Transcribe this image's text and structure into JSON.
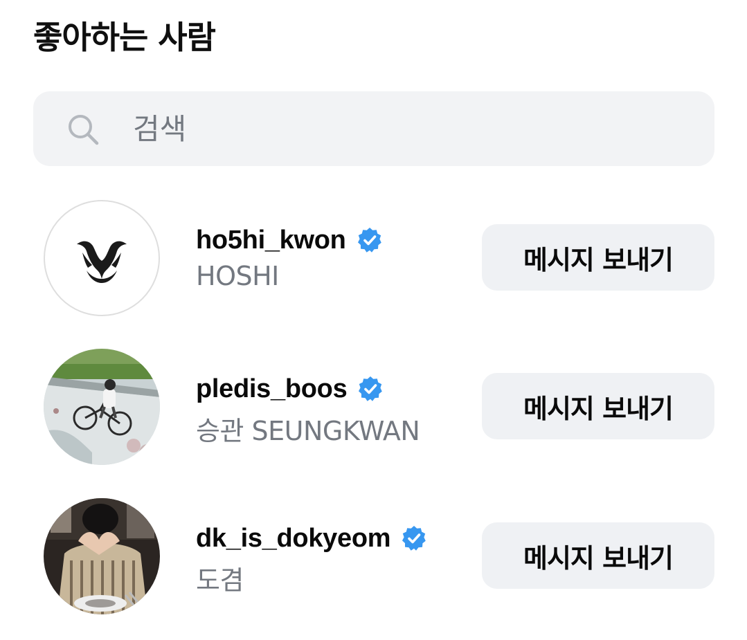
{
  "header": {
    "title": "좋아하는 사람"
  },
  "search": {
    "placeholder": "검색",
    "value": ""
  },
  "likers": [
    {
      "username": "ho5hi_kwon",
      "full_name": "HOSHI",
      "verified": true,
      "button_label": "메시지 보내기"
    },
    {
      "username": "pledis_boos",
      "full_name": "승관 SEUNGKWAN",
      "verified": true,
      "button_label": "메시지 보내기"
    },
    {
      "username": "dk_is_dokyeom",
      "full_name": "도겸",
      "verified": true,
      "button_label": "메시지 보내기"
    }
  ],
  "colors": {
    "verified_badge": "#3797f0",
    "secondary_text": "#737880",
    "button_bg": "#eff1f4",
    "search_bg": "#f2f3f5"
  },
  "icons": {
    "search": "search-icon",
    "verified": "verified-badge-icon"
  }
}
